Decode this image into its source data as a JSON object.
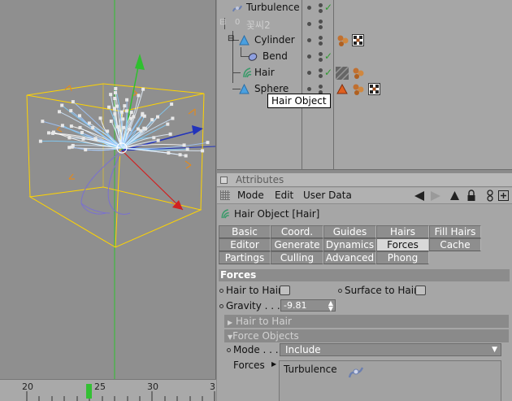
{
  "object_manager": {
    "rows": [
      {
        "label": "Turbulence",
        "dim": false
      },
      {
        "label": "꽃씨2",
        "dim": true
      },
      {
        "label": "Cylinder",
        "dim": false
      },
      {
        "label": "Bend",
        "dim": false
      },
      {
        "label": "Hair",
        "dim": false
      },
      {
        "label": "Sphere",
        "dim": false
      }
    ],
    "tooltip": "Hair Object"
  },
  "timeline": {
    "ticks": [
      "20",
      "25",
      "30",
      "3"
    ]
  },
  "attributes": {
    "panel_title": "Attributes",
    "menu": {
      "mode": "Mode",
      "edit": "Edit",
      "user_data": "User Data"
    },
    "object_title": "Hair Object [Hair]",
    "tabs_row1": [
      "Basic",
      "Coord.",
      "Guides",
      "Hairs",
      "Fill Hairs"
    ],
    "tabs_row2": [
      "Editor",
      "Generate",
      "Dynamics",
      "Forces",
      "Cache"
    ],
    "tabs_row3": [
      "Partings",
      "Culling",
      "Advanced",
      "Phong"
    ],
    "active_tab": "Forces",
    "section_title": "Forces",
    "hair_to_hair_label": "Hair to Hair",
    "surface_to_hair_label": "Surface to Hair",
    "gravity_label": "Gravity . . . .",
    "gravity_value": "-9.81",
    "group_hair_to_hair": "Hair to Hair",
    "group_force_objects": "Force Objects",
    "mode_label": "Mode . . .",
    "mode_value": "Include",
    "forces_label": "Forces",
    "forces_entries": [
      "Turbulence"
    ]
  },
  "colors": {
    "viewport_bg": "#8f8f8f",
    "panel_bg": "#a6a6a6",
    "bbox": "#ffd400",
    "axis_y": "#2fc02f",
    "axis_x": "#d02020",
    "axis_z": "#2020c0",
    "check": "#2f9a2f",
    "playhead": "#33c033"
  }
}
